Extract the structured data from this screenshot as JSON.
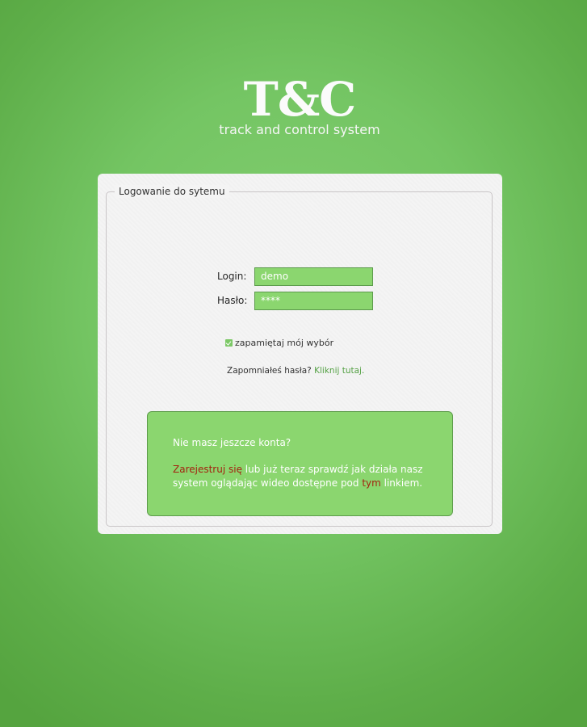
{
  "brand": {
    "logo": "T&C",
    "tagline": "track and control system"
  },
  "login_form": {
    "legend": "Logowanie do sytemu",
    "login_label": "Login:",
    "login_value": "demo",
    "password_label": "Hasło:",
    "password_value": "****",
    "remember_label": "zapamiętaj mój wybór",
    "remember_checked": true,
    "forgot_text": "Zapomniałeś hasła?",
    "forgot_link": "Kliknij tutaj."
  },
  "promo": {
    "title": "Nie masz jeszcze konta?",
    "register_link": "Zarejestruj się",
    "text_part1": " lub już teraz sprawdź jak działa nasz system oglądając wideo dostępne pod ",
    "video_link": "tym",
    "text_part2": " linkiem."
  },
  "colors": {
    "background": "#74c563",
    "input_fill": "#8bd66f",
    "link_green": "#54a144",
    "link_red": "#a3230f"
  },
  "icons": {
    "remember_checkbox": "checkmark-icon"
  }
}
